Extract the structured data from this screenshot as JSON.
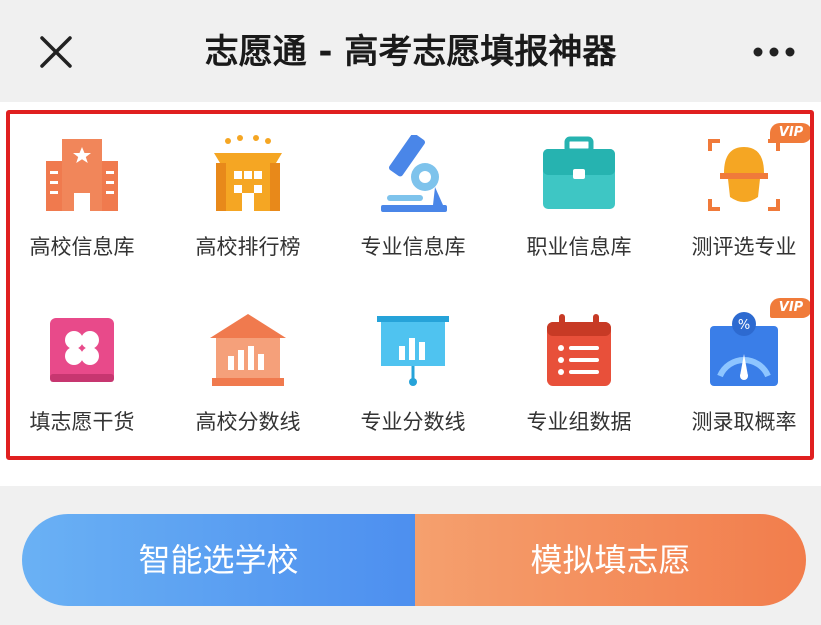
{
  "header": {
    "title": "志愿通 - 高考志愿填报神器",
    "close_icon": "close-icon",
    "more_icon": "more-dots-icon"
  },
  "grid": {
    "row1": [
      {
        "label": "高校信息库",
        "icon": "university-buildings-icon"
      },
      {
        "label": "高校排行榜",
        "icon": "ranked-building-icon"
      },
      {
        "label": "专业信息库",
        "icon": "microscope-icon"
      },
      {
        "label": "职业信息库",
        "icon": "briefcase-icon"
      },
      {
        "label": "测评选专业",
        "icon": "head-scan-icon",
        "badge": "VIP"
      }
    ],
    "row2": [
      {
        "label": "填志愿干货",
        "icon": "clover-card-icon"
      },
      {
        "label": "高校分数线",
        "icon": "bank-chart-icon"
      },
      {
        "label": "专业分数线",
        "icon": "presentation-board-icon"
      },
      {
        "label": "专业组数据",
        "icon": "calendar-list-icon"
      },
      {
        "label": "测录取概率",
        "icon": "gauge-percent-icon",
        "badge": "VIP"
      }
    ]
  },
  "actions": {
    "smart_select_label": "智能选学校",
    "simulate_fill_label": "模拟填志愿"
  },
  "colors": {
    "highlight": "#e02020",
    "blue": "#4d8fef",
    "orange": "#f27d4c",
    "vip": "#f07b3a"
  }
}
